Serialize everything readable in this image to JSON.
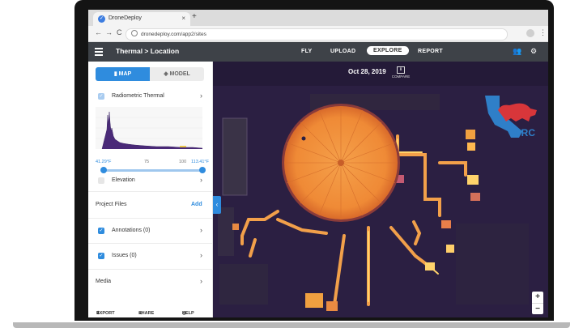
{
  "browser": {
    "tab_title": "DroneDeploy",
    "tab_close": "×",
    "new_tab": "+",
    "url": "dronedeploy.com/app2/sites",
    "back": "←",
    "forward": "→",
    "reload": "C",
    "menu": "⋮"
  },
  "app": {
    "title": "Thermal > Location",
    "nav": [
      {
        "label": "FLY",
        "active": false
      },
      {
        "label": "UPLOAD",
        "active": false
      },
      {
        "label": "EXPLORE",
        "active": true
      },
      {
        "label": "REPORT",
        "active": false
      }
    ],
    "icons": [
      "users-icon",
      "gear-icon"
    ],
    "icon_glyphs": {
      "users": "👥",
      "gear": "⚙"
    }
  },
  "sidebar": {
    "view_toggle": [
      {
        "label": "MAP",
        "active": true,
        "icon": "map-icon"
      },
      {
        "label": "MODEL",
        "active": false,
        "icon": "cube-icon"
      }
    ],
    "layers": [
      {
        "label": "Radiometric Thermal",
        "checked": true
      },
      {
        "label": "Elevation",
        "checked": false
      }
    ],
    "histogram": {
      "min_label": "41.29°F",
      "tick_75": "75",
      "tick_100": "100",
      "max_label": "113.41°F"
    },
    "project_files": {
      "label": "Project Files",
      "add_label": "Add",
      "items": [
        {
          "label": "Annotations (0)",
          "checked": true
        },
        {
          "label": "Issues (0)",
          "checked": true
        }
      ]
    },
    "media_label": "Media",
    "footer": {
      "export": "EXPORT",
      "share": "SHARE",
      "help": "HELP"
    },
    "chevron": "›",
    "check_mark": "✓"
  },
  "map": {
    "date": "Oct 28, 2019",
    "compare_label": "COMPARE",
    "zoom_in": "+",
    "zoom_out": "−",
    "collapse": "‹",
    "logo_text": "CRC"
  },
  "colors": {
    "accent": "#2f8cde",
    "app_bar": "#3e4248",
    "map_bg": "#2b1f42",
    "thermal_hot": "#f39a3d",
    "thermal_warm": "#ffd36b"
  }
}
